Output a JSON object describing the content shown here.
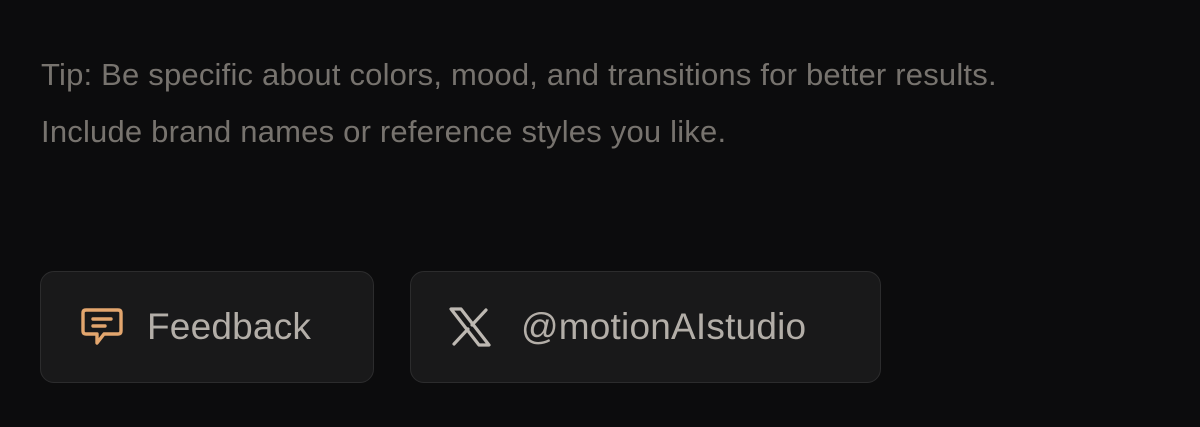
{
  "tip": {
    "text": "Tip: Be specific about colors, mood, and transitions for better results. Include brand names or reference styles you like."
  },
  "buttons": {
    "feedback": {
      "icon": "message-square-icon",
      "label": "Feedback"
    },
    "social": {
      "icon": "x-logo-icon",
      "label": "@motionAIstudio"
    }
  },
  "colors": {
    "background": "#0c0c0d",
    "tip_text": "#77736e",
    "button_bg": "#19191a",
    "button_border": "#2c2c2d",
    "button_text": "#b3aea8",
    "feedback_icon": "#e3a66e",
    "x_icon": "#bdb8b2"
  }
}
